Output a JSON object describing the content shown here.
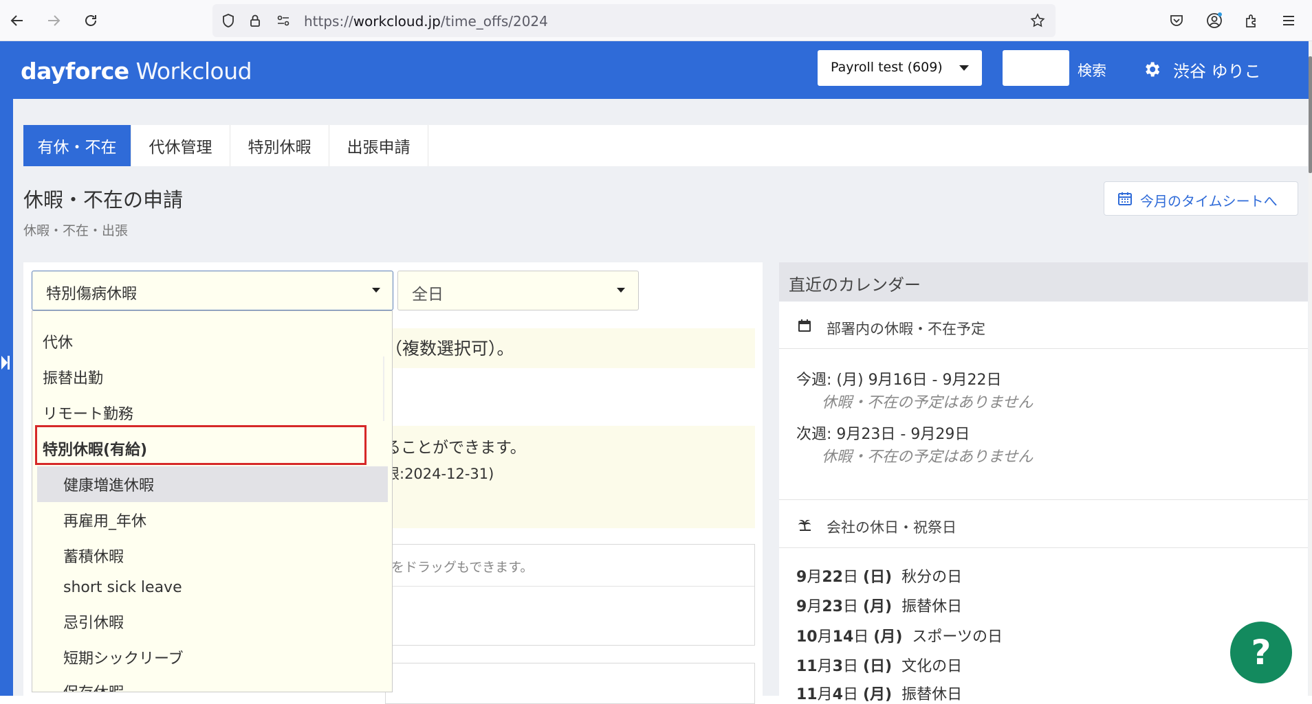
{
  "browser": {
    "url_prefix": "https://",
    "url_host": "workcloud.jp",
    "url_path": "/time_offs/2024"
  },
  "header": {
    "logo_bold": "dayforce",
    "logo_light": " Workcloud",
    "company_select": "Payroll test (609)",
    "search_label": "検索",
    "user_name": "渋谷 ゆりこ"
  },
  "tabs": [
    {
      "label": "有休・不在",
      "active": true
    },
    {
      "label": "代休管理",
      "active": false
    },
    {
      "label": "特別休暇",
      "active": false
    },
    {
      "label": "出張申請",
      "active": false
    }
  ],
  "page": {
    "title": "休暇・不在の申請",
    "breadcrumb": "休暇・不在・出張",
    "timesheet_button": "今月のタイムシートへ"
  },
  "form": {
    "type_select_value": "特別傷病休暇",
    "day_select_value": "全日",
    "note_multi_select": "（複数選択可）。",
    "note_can_do": "ることができます。",
    "note_deadline": "限:2024-12-31)",
    "drop_hint": "をドラッグもできます。"
  },
  "dropdown": {
    "items": [
      {
        "label": "代休",
        "indent": false,
        "bold": false
      },
      {
        "label": "振替出勤",
        "indent": false,
        "bold": false
      },
      {
        "label": "リモート勤務",
        "indent": false,
        "bold": false
      },
      {
        "label": "特別休暇(有給)",
        "indent": false,
        "bold": true
      },
      {
        "label": "健康増進休暇",
        "indent": true,
        "bold": false
      },
      {
        "label": "再雇用_年休",
        "indent": true,
        "bold": false
      },
      {
        "label": "蓄積休暇",
        "indent": true,
        "bold": false
      },
      {
        "label": "short sick leave",
        "indent": true,
        "bold": false
      },
      {
        "label": "忌引休暇",
        "indent": true,
        "bold": false
      },
      {
        "label": "短期シックリーブ",
        "indent": true,
        "bold": false
      },
      {
        "label": "保存休暇",
        "indent": true,
        "bold": false
      }
    ]
  },
  "calendar": {
    "header": "直近のカレンダー",
    "dept_section": "部署内の休暇・不在予定",
    "this_week": "今週: (月) 9月16日 - 9月22日",
    "this_week_none": "休暇・不在の予定はありません",
    "next_week": "次週: 9月23日 - 9月29日",
    "next_week_none": "休暇・不在の予定はありません",
    "holiday_section": "会社の休日・祝祭日",
    "holidays": [
      {
        "m": "9",
        "d": "22",
        "dow": "日",
        "name": "秋分の日"
      },
      {
        "m": "9",
        "d": "23",
        "dow": "月",
        "name": "振替休日"
      },
      {
        "m": "10",
        "d": "14",
        "dow": "月",
        "name": "スポーツの日"
      },
      {
        "m": "11",
        "d": "3",
        "dow": "日",
        "name": "文化の日"
      },
      {
        "m": "11",
        "d": "4",
        "dow": "月",
        "name": "振替休日"
      }
    ]
  },
  "help": {
    "label": "?"
  },
  "colors": {
    "brand": "#2f6bd8",
    "help": "#138a5e",
    "highlight": "#d62828"
  }
}
